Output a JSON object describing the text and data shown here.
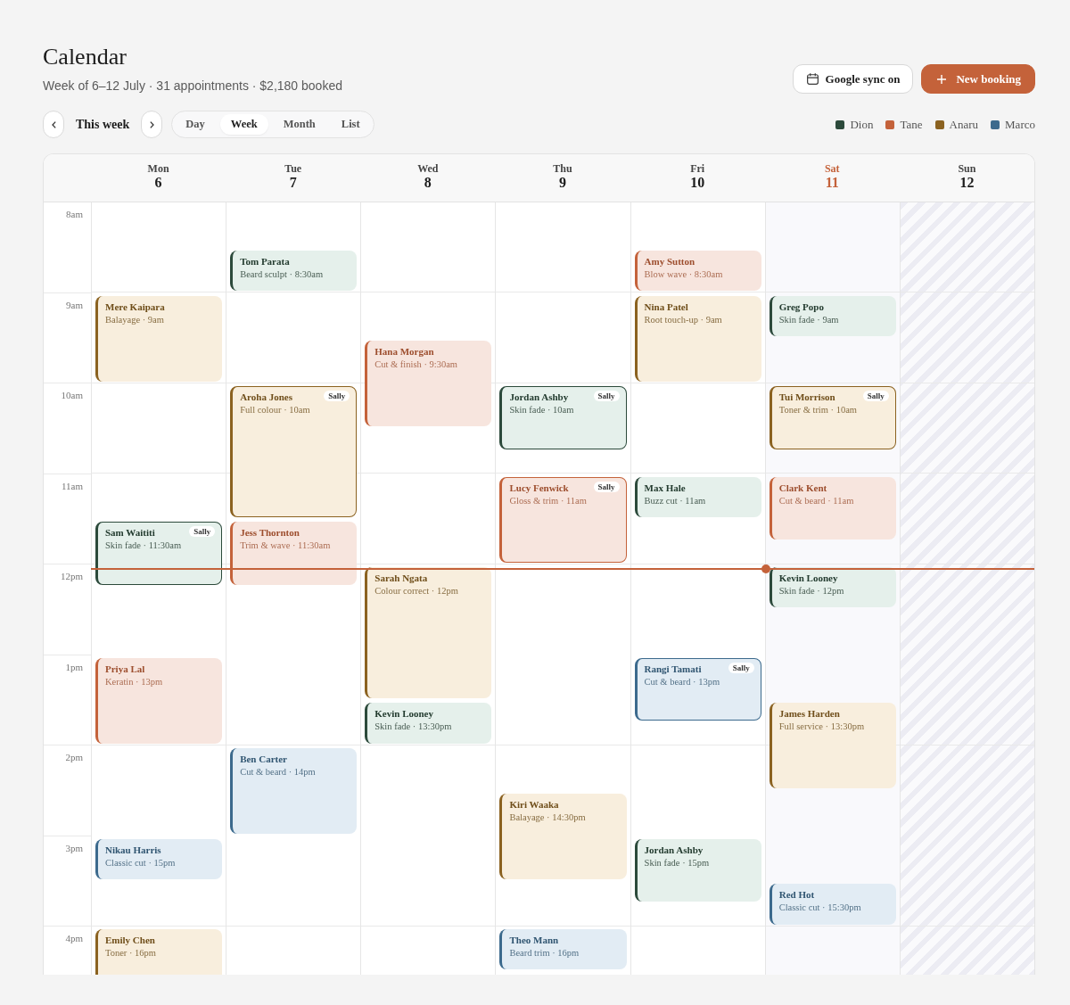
{
  "header": {
    "title": "Calendar",
    "subtitle": "Week of 6–12 July · 31 appointments · $2,180 booked"
  },
  "actions": [
    {
      "kind": "sync",
      "label": "Google sync on"
    },
    {
      "kind": "create",
      "label": "New booking"
    }
  ],
  "navigation": {
    "period": "This week"
  },
  "views": [
    {
      "label": "Day",
      "selected": false
    },
    {
      "label": "Week",
      "selected": true
    },
    {
      "label": "Month",
      "selected": false
    },
    {
      "label": "List",
      "selected": false
    }
  ],
  "legend": [
    {
      "label": "Dion",
      "color": "#2c4a3b"
    },
    {
      "label": "Tane",
      "color": "#c4623a"
    },
    {
      "label": "Anaru",
      "color": "#8b6220"
    },
    {
      "label": "Marco",
      "color": "#3c6a8d"
    }
  ],
  "calendar": {
    "hours": [
      {
        "label": "8am",
        "current": false
      },
      {
        "label": "9am",
        "current": false
      },
      {
        "label": "10am",
        "current": false
      },
      {
        "label": "11am",
        "current": false
      },
      {
        "label": "12pm",
        "current": true
      },
      {
        "label": "1pm",
        "current": false
      },
      {
        "label": "2pm",
        "current": false
      },
      {
        "label": "3pm",
        "current": false
      },
      {
        "label": "4pm",
        "current": false
      }
    ],
    "days": [
      {
        "weekday": "Mon",
        "date": "6",
        "today": false,
        "closed": false,
        "events": [
          {
            "name": "Mere Kaipara",
            "detail": "Balayage · 9am",
            "kind": "long",
            "color": "#8b6220"
          },
          {
            "name": "Sam Waititi",
            "detail": "Skin fade · 11:30am",
            "kind": "medium",
            "color": "#2c4a3b",
            "badge": "Sally"
          },
          {
            "name": "Priya Lal",
            "detail": "Keratin · 13pm",
            "kind": "long",
            "color": "#c4623a"
          },
          {
            "name": "Nikau Harris",
            "detail": "Classic cut · 15pm",
            "kind": "short",
            "color": "#3c6a8d"
          },
          {
            "name": "Emily Chen",
            "detail": "Toner · 16pm",
            "kind": "long",
            "color": "#8b6220"
          }
        ]
      },
      {
        "weekday": "Tue",
        "date": "7",
        "today": false,
        "closed": false,
        "events": [
          {
            "name": "Tom Parata",
            "detail": "Beard sculpt · 8:30am",
            "kind": "short",
            "color": "#2c4a3b"
          },
          {
            "name": "Aroha Jones",
            "detail": "Full colour · 10am",
            "kind": "extended",
            "color": "#8b6220",
            "badge": "Sally"
          },
          {
            "name": "Jess Thornton",
            "detail": "Trim & wave · 11:30am",
            "kind": "medium",
            "color": "#c4623a"
          },
          {
            "name": "Ben Carter",
            "detail": "Cut & beard · 14pm",
            "kind": "long",
            "color": "#3c6a8d"
          }
        ]
      },
      {
        "weekday": "Wed",
        "date": "8",
        "today": false,
        "closed": false,
        "events": [
          {
            "name": "Hana Morgan",
            "detail": "Cut & finish · 9:30am",
            "kind": "long",
            "color": "#c4623a"
          },
          {
            "name": "Sarah Ngata",
            "detail": "Colour correct · 12pm",
            "kind": "extended",
            "color": "#8b6220"
          },
          {
            "name": "Kevin Looney",
            "detail": "Skin fade · 13:30pm",
            "kind": "short",
            "color": "#2c4a3b"
          }
        ]
      },
      {
        "weekday": "Thu",
        "date": "9",
        "today": false,
        "closed": false,
        "events": [
          {
            "name": "Jordan Ashby",
            "detail": "Skin fade · 10am",
            "kind": "medium",
            "color": "#2c4a3b",
            "badge": "Sally"
          },
          {
            "name": "Lucy Fenwick",
            "detail": "Gloss & trim · 11am",
            "kind": "long",
            "color": "#c4623a",
            "badge": "Sally"
          },
          {
            "name": "Kiri Waaka",
            "detail": "Balayage · 14:30pm",
            "kind": "long",
            "color": "#8b6220"
          },
          {
            "name": "Theo Mann",
            "detail": "Beard trim · 16pm",
            "kind": "short",
            "color": "#3c6a8d"
          }
        ]
      },
      {
        "weekday": "Fri",
        "date": "10",
        "today": false,
        "closed": false,
        "events": [
          {
            "name": "Amy Sutton",
            "detail": "Blow wave · 8:30am",
            "kind": "short",
            "color": "#c4623a"
          },
          {
            "name": "Nina Patel",
            "detail": "Root touch-up · 9am",
            "kind": "long",
            "color": "#8b6220"
          },
          {
            "name": "Max Hale",
            "detail": "Buzz cut · 11am",
            "kind": "short",
            "color": "#2c4a3b"
          },
          {
            "name": "Rangi Tamati",
            "detail": "Cut & beard · 13pm",
            "kind": "medium",
            "color": "#3c6a8d",
            "badge": "Sally"
          },
          {
            "name": "Jordan Ashby",
            "detail": "Skin fade · 15pm",
            "kind": "medium",
            "color": "#2c4a3b"
          }
        ]
      },
      {
        "weekday": "Sat",
        "date": "11",
        "today": true,
        "closed": false,
        "events": [
          {
            "name": "Greg Popo",
            "detail": "Skin fade · 9am",
            "kind": "short",
            "color": "#2c4a3b"
          },
          {
            "name": "Tui Morrison",
            "detail": "Toner & trim · 10am",
            "kind": "medium",
            "color": "#8b6220",
            "badge": "Sally"
          },
          {
            "name": "Clark Kent",
            "detail": "Cut & beard · 11am",
            "kind": "medium",
            "color": "#c4623a"
          },
          {
            "name": "Kevin Looney",
            "detail": "Skin fade · 12pm",
            "kind": "short",
            "color": "#2c4a3b"
          },
          {
            "name": "James Harden",
            "detail": "Full service · 13:30pm",
            "kind": "long",
            "color": "#8b6220"
          },
          {
            "name": "Red Hot",
            "detail": "Classic cut · 15:30pm",
            "kind": "short",
            "color": "#3c6a8d"
          }
        ]
      },
      {
        "weekday": "Sun",
        "date": "12",
        "today": false,
        "closed": true
      }
    ]
  }
}
